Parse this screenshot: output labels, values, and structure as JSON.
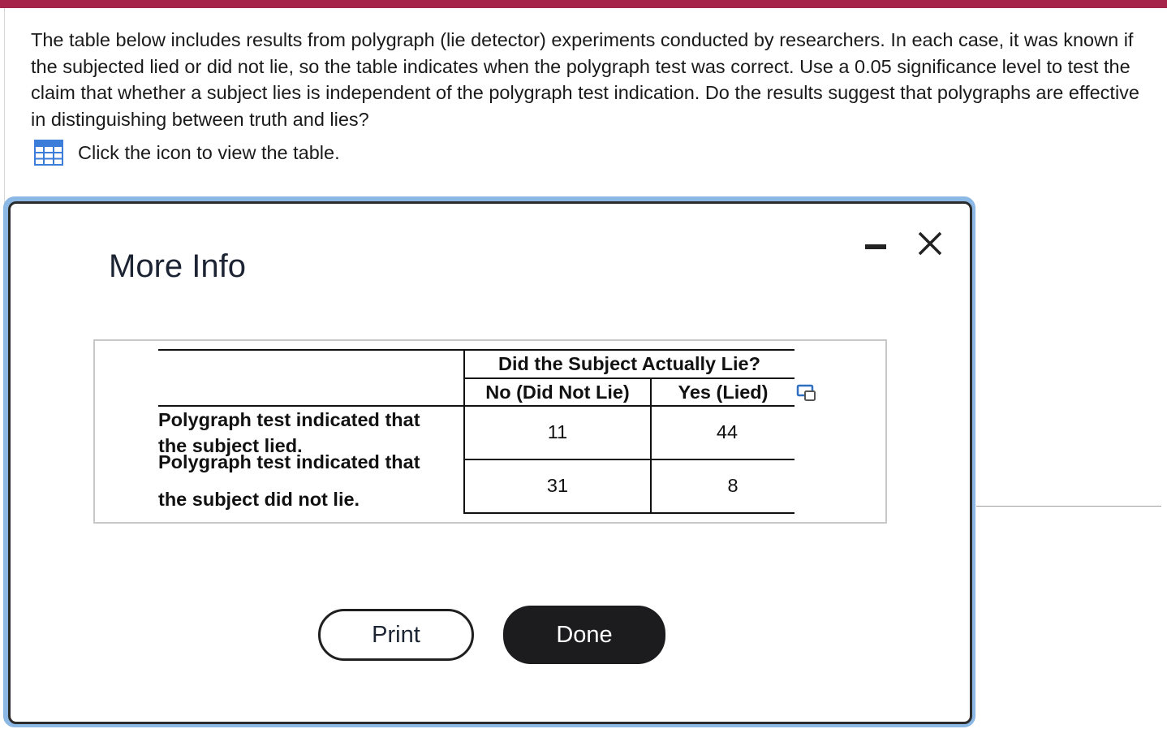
{
  "question": {
    "text": "The table below includes results from polygraph (lie detector) experiments conducted by researchers. In each case, it was known if the subjected lied or did not lie, so the table indicates when the polygraph test was correct. Use a 0.05 significance level to test the claim that whether a subject lies is independent of the polygraph test indication. Do the results suggest that polygraphs are effective in distinguishing between truth and lies?",
    "table_link_text": "Click the icon to view the table.",
    "table_icon": "table-grid-icon"
  },
  "modal": {
    "title": "More Info",
    "minimize_icon": "minimize-icon",
    "close_icon": "close-icon",
    "table": {
      "group_header": "Did the Subject Actually Lie?",
      "columns": [
        "No (Did Not Lie)",
        "Yes (Lied)"
      ],
      "rows": [
        {
          "label_line1": "Polygraph test indicated that",
          "label_line2": "the subject lied.",
          "values": [
            "11",
            "44"
          ]
        },
        {
          "label_line1": "Polygraph test indicated that",
          "label_line2": "the subject did not lie.",
          "values": [
            "31",
            "8"
          ]
        }
      ],
      "copy_icon": "copy-icon"
    },
    "buttons": {
      "print_label": "Print",
      "done_label": "Done"
    }
  },
  "colors": {
    "top_bar": "#a6234a",
    "modal_frame": "#8cb8e6",
    "done_button": "#1c1c1e",
    "table_icon": "#3b7dd8"
  }
}
